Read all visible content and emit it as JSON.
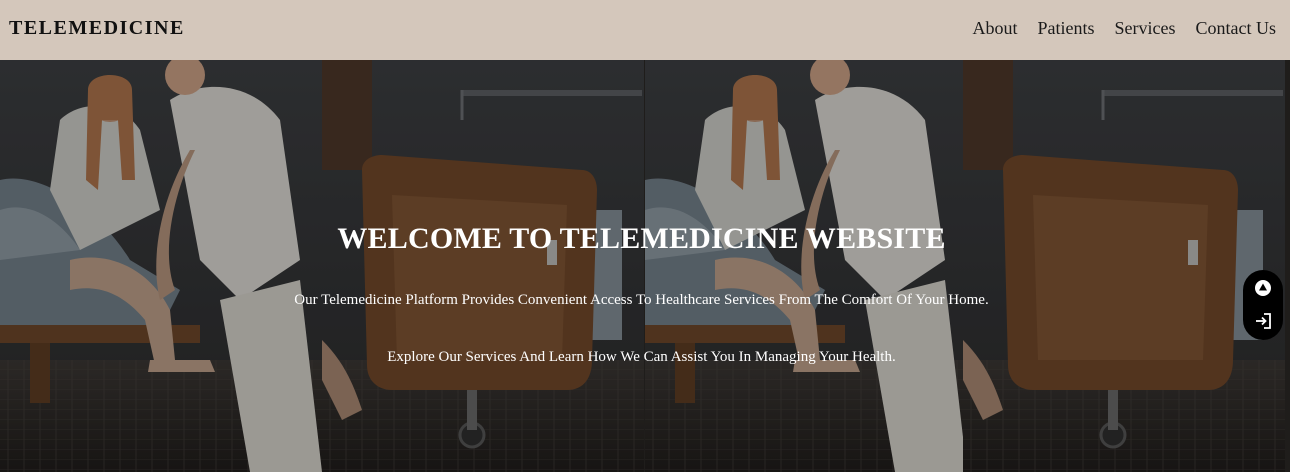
{
  "header": {
    "brand": "TELEMEDICINE",
    "nav": [
      {
        "label": "About"
      },
      {
        "label": "Patients"
      },
      {
        "label": "Services"
      },
      {
        "label": "Contact Us"
      }
    ],
    "background_color": "#d4c7bb"
  },
  "hero": {
    "title": "WELCOME TO TELEMEDICINE WEBSITE",
    "paragraph_1": "Our Telemedicine Platform Provides Convenient Access To Healthcare Services From The Comfort Of Your Home.",
    "paragraph_2": "Explore Our Services And Learn How We Can Assist You In Managing Your Health.",
    "background_image": "nurse-helping-patient-hospital-bed-photo"
  },
  "side_widget": {
    "icons": [
      "scroll-up-icon",
      "login-icon"
    ]
  }
}
